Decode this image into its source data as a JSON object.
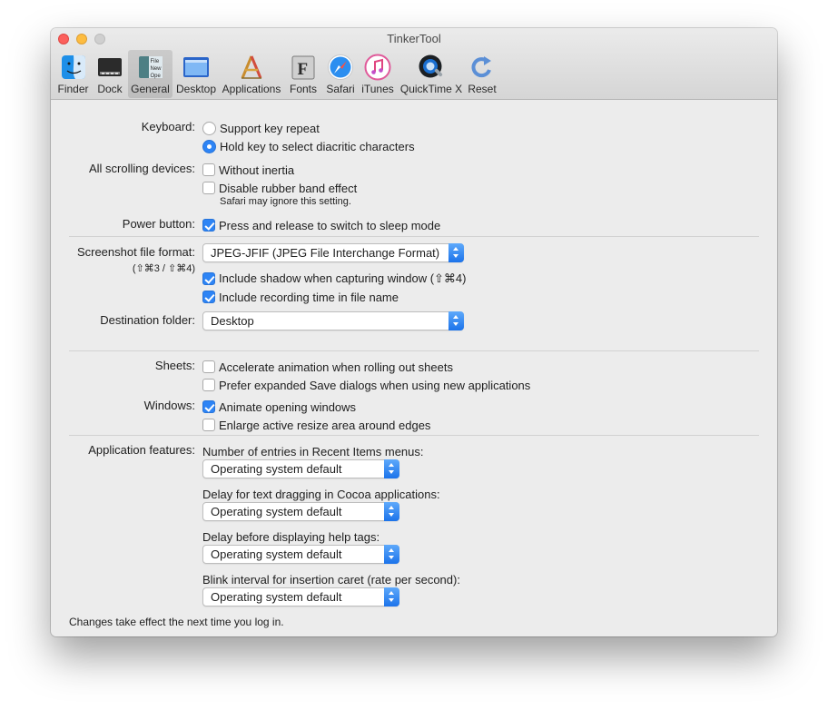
{
  "window": {
    "title": "TinkerTool"
  },
  "toolbar": {
    "items": [
      {
        "label": "Finder",
        "icon": "finder-icon"
      },
      {
        "label": "Dock",
        "icon": "dock-icon"
      },
      {
        "label": "General",
        "icon": "general-icon",
        "selected": true
      },
      {
        "label": "Desktop",
        "icon": "desktop-icon"
      },
      {
        "label": "Applications",
        "icon": "applications-icon"
      },
      {
        "label": "Fonts",
        "icon": "fonts-icon"
      },
      {
        "label": "Safari",
        "icon": "safari-icon"
      },
      {
        "label": "iTunes",
        "icon": "itunes-icon"
      },
      {
        "label": "QuickTime X",
        "icon": "quicktime-icon"
      },
      {
        "label": "Reset",
        "icon": "reset-icon"
      }
    ],
    "general_icon_text": [
      "File",
      "New",
      "Ope"
    ],
    "fonts_icon_letter": "F"
  },
  "keyboard": {
    "label": "Keyboard:",
    "option1": "Support key repeat",
    "option2": "Hold key to select diacritic characters",
    "selected": 2
  },
  "scrolling": {
    "label": "All scrolling devices:",
    "without_inertia": "Without inertia",
    "without_inertia_checked": false,
    "disable_rubber_band": "Disable rubber band effect",
    "disable_rubber_band_checked": false,
    "note": "Safari may ignore this setting."
  },
  "power": {
    "label": "Power button:",
    "option": "Press and release to switch to sleep mode",
    "checked": true
  },
  "screenshot": {
    "label": "Screenshot file format:",
    "sublabel": "(⇧⌘3 / ⇧⌘4)",
    "format_value": "JPEG-JFIF (JPEG File Interchange Format)",
    "include_shadow": "Include shadow when capturing window (⇧⌘4)",
    "include_shadow_checked": true,
    "include_recording_time": "Include recording time in file name",
    "include_recording_time_checked": true,
    "destination_label": "Destination folder:",
    "destination_value": "Desktop"
  },
  "sheets": {
    "label": "Sheets:",
    "accelerate": "Accelerate animation when rolling out sheets",
    "accelerate_checked": false,
    "prefer_expanded": "Prefer expanded Save dialogs when using new applications",
    "prefer_expanded_checked": false
  },
  "windows": {
    "label": "Windows:",
    "animate": "Animate opening windows",
    "animate_checked": true,
    "enlarge": "Enlarge active resize area around edges",
    "enlarge_checked": false
  },
  "app_features": {
    "label": "Application features:",
    "recent_items_label": "Number of entries in Recent Items menus:",
    "recent_items_value": "Operating system default",
    "text_drag_label": "Delay for text dragging in Cocoa applications:",
    "text_drag_value": "Operating system default",
    "help_tags_label": "Delay before displaying help tags:",
    "help_tags_value": "Operating system default",
    "blink_label": "Blink interval for insertion caret (rate per second):",
    "blink_value": "Operating system default"
  },
  "footer": {
    "text": "Changes take effect the next time you log in."
  },
  "colors": {
    "accent": "#2d84f5",
    "close": "#fc605c",
    "minimize": "#fdbc40",
    "zoom_inactive": "#cfcfcf",
    "window_bg": "#ececec"
  }
}
